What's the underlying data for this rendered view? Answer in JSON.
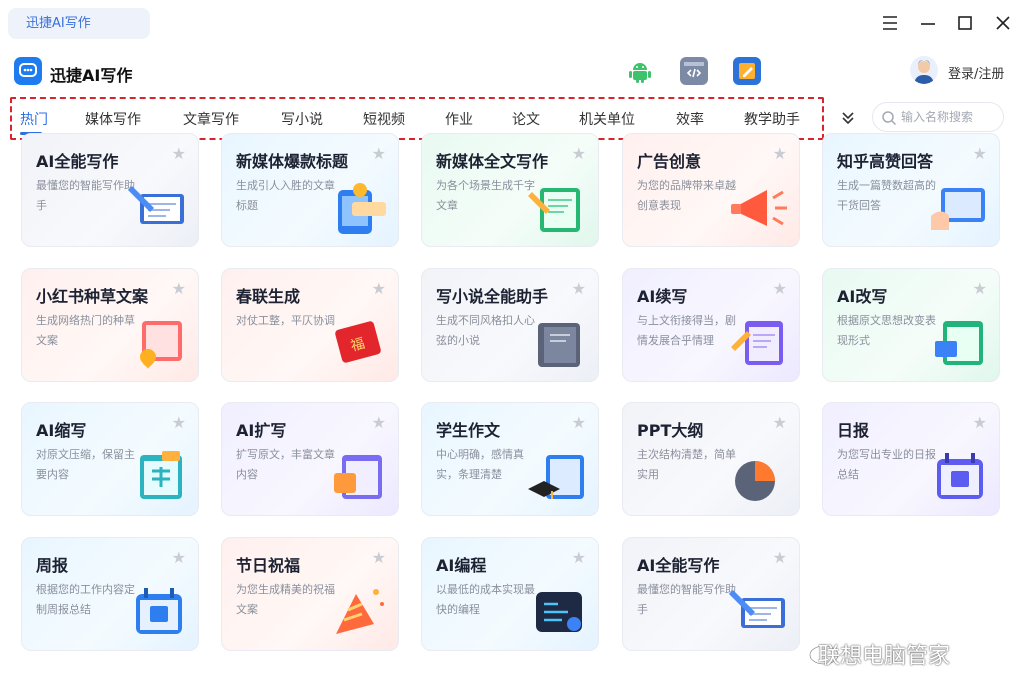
{
  "window": {
    "tab_label": "迅捷AI写作"
  },
  "header": {
    "app_name": "迅捷AI写作",
    "login_label": "登录/注册",
    "icons": [
      "android-icon",
      "code-window-icon",
      "notepad-icon"
    ]
  },
  "tabs": [
    {
      "label": "热门",
      "active": true
    },
    {
      "label": "媒体写作"
    },
    {
      "label": "文章写作"
    },
    {
      "label": "写小说"
    },
    {
      "label": "短视频"
    },
    {
      "label": "作业"
    },
    {
      "label": "论文"
    },
    {
      "label": "机关单位"
    },
    {
      "label": "效率"
    },
    {
      "label": "教学助手"
    }
  ],
  "search": {
    "placeholder": "输入名称搜索"
  },
  "cards": [
    {
      "title": "AI全能写作",
      "desc": "最懂您的智能写作助手",
      "theme": "gray"
    },
    {
      "title": "新媒体爆款标题",
      "desc": "生成引人入胜的文章标题",
      "theme": "cyan"
    },
    {
      "title": "新媒体全文写作",
      "desc": "为各个场景生成千字文章",
      "theme": "green"
    },
    {
      "title": "广告创意",
      "desc": "为您的品牌带来卓越创意表现",
      "theme": "pink"
    },
    {
      "title": "知乎高赞回答",
      "desc": "生成一篇赞数超高的干货回答",
      "theme": "cyan"
    },
    {
      "title": "小红书种草文案",
      "desc": "生成网络热门的种草文案",
      "theme": "pink"
    },
    {
      "title": "春联生成",
      "desc": "对仗工整，平仄协调",
      "theme": "pink"
    },
    {
      "title": "写小说全能助手",
      "desc": "生成不同风格扣人心弦的小说",
      "theme": "gray"
    },
    {
      "title": "AI续写",
      "desc": "与上文衔接得当，剧情发展合乎情理",
      "theme": "purple"
    },
    {
      "title": "AI改写",
      "desc": "根据原文思想改变表现形式",
      "theme": "green"
    },
    {
      "title": "AI缩写",
      "desc": "对原文压缩，保留主要内容",
      "theme": "cyan"
    },
    {
      "title": "AI扩写",
      "desc": "扩写原文，丰富文章内容",
      "theme": "purple"
    },
    {
      "title": "学生作文",
      "desc": "中心明确，感情真实，条理清楚",
      "theme": "cyan"
    },
    {
      "title": "PPT大纲",
      "desc": "主次结构清楚，简单实用",
      "theme": "gray"
    },
    {
      "title": "日报",
      "desc": "为您写出专业的日报总结",
      "theme": "purple"
    },
    {
      "title": "周报",
      "desc": "根据您的工作内容定制周报总结",
      "theme": "cyan"
    },
    {
      "title": "节日祝福",
      "desc": "为您生成精美的祝福文案",
      "theme": "pink"
    },
    {
      "title": "AI编程",
      "desc": "以最低的成本实现最快的编程",
      "theme": "cyan"
    },
    {
      "title": "AI全能写作",
      "desc": "最懂您的智能写作助手",
      "theme": "gray"
    }
  ],
  "watermark": "联想电脑管家"
}
